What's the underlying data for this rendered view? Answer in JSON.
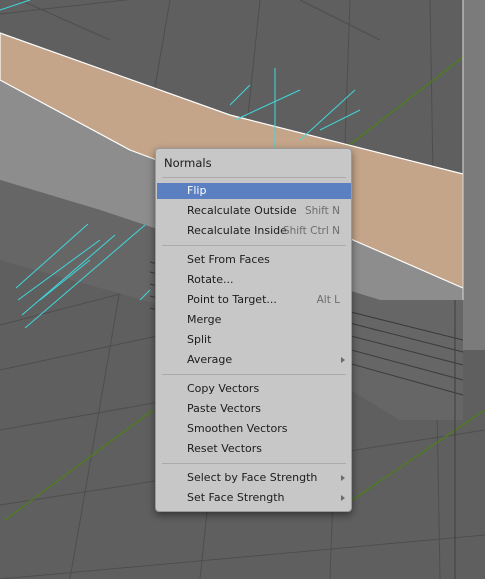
{
  "viewport": {
    "background": "#5f5f5f",
    "grid_color": "#4e4e4e",
    "axis_color": "#4f7a24",
    "normal_color": "#3fd8dc",
    "selected_face_color": "#c4a58a",
    "side_face_color": "#8c8c8c"
  },
  "menu": {
    "title": "Normals",
    "selected_color": "#5b80c2",
    "groups": [
      [
        {
          "label": "Flip",
          "shortcut": "",
          "submenu": false,
          "active": true
        },
        {
          "label": "Recalculate Outside",
          "shortcut": "Shift N",
          "submenu": false,
          "active": false
        },
        {
          "label": "Recalculate Inside",
          "shortcut": "Shift Ctrl N",
          "submenu": false,
          "active": false
        }
      ],
      [
        {
          "label": "Set From Faces",
          "shortcut": "",
          "submenu": false,
          "active": false
        },
        {
          "label": "Rotate...",
          "shortcut": "",
          "submenu": false,
          "active": false
        },
        {
          "label": "Point to Target...",
          "shortcut": "Alt L",
          "submenu": false,
          "active": false
        },
        {
          "label": "Merge",
          "shortcut": "",
          "submenu": false,
          "active": false
        },
        {
          "label": "Split",
          "shortcut": "",
          "submenu": false,
          "active": false
        },
        {
          "label": "Average",
          "shortcut": "",
          "submenu": true,
          "active": false
        }
      ],
      [
        {
          "label": "Copy Vectors",
          "shortcut": "",
          "submenu": false,
          "active": false
        },
        {
          "label": "Paste Vectors",
          "shortcut": "",
          "submenu": false,
          "active": false
        },
        {
          "label": "Smoothen Vectors",
          "shortcut": "",
          "submenu": false,
          "active": false
        },
        {
          "label": "Reset Vectors",
          "shortcut": "",
          "submenu": false,
          "active": false
        }
      ],
      [
        {
          "label": "Select by Face Strength",
          "shortcut": "",
          "submenu": true,
          "active": false
        },
        {
          "label": "Set Face Strength",
          "shortcut": "",
          "submenu": true,
          "active": false
        }
      ]
    ]
  }
}
